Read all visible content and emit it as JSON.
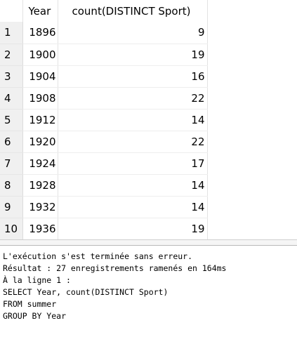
{
  "results": {
    "columns": [
      "Year",
      "count(DISTINCT Sport)"
    ],
    "rows": [
      {
        "num": "1",
        "year": "1896",
        "count": "9"
      },
      {
        "num": "2",
        "year": "1900",
        "count": "19"
      },
      {
        "num": "3",
        "year": "1904",
        "count": "16"
      },
      {
        "num": "4",
        "year": "1908",
        "count": "22"
      },
      {
        "num": "5",
        "year": "1912",
        "count": "14"
      },
      {
        "num": "6",
        "year": "1920",
        "count": "22"
      },
      {
        "num": "7",
        "year": "1924",
        "count": "17"
      },
      {
        "num": "8",
        "year": "1928",
        "count": "14"
      },
      {
        "num": "9",
        "year": "1932",
        "count": "14"
      },
      {
        "num": "10",
        "year": "1936",
        "count": "19"
      }
    ]
  },
  "log": {
    "lines": [
      "L'exécution s'est terminée sans erreur.",
      "Résultat : 27 enregistrements ramenés en 164ms",
      "À la ligne 1 :",
      "SELECT Year, count(DISTINCT Sport)",
      "FROM summer",
      "GROUP BY Year"
    ]
  }
}
